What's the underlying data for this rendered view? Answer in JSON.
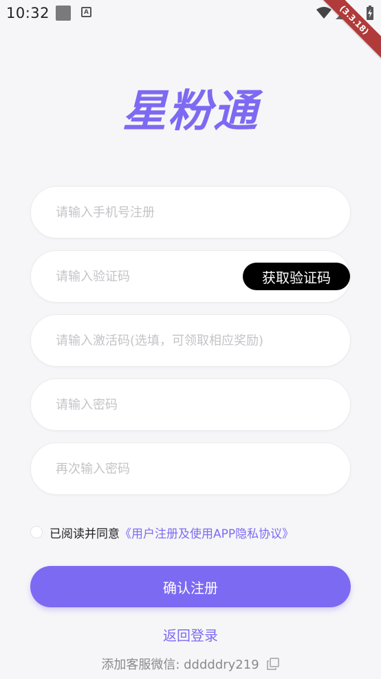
{
  "status_bar": {
    "time": "10:32",
    "a_icon_text": "A",
    "debug_banner": "(3.3.18)"
  },
  "logo": {
    "text": "星粉通"
  },
  "form": {
    "phone_placeholder": "请输入手机号注册",
    "code_placeholder": "请输入验证码",
    "get_code_label": "获取验证码",
    "activation_placeholder": "请输入激活码(选填，可领取相应奖励)",
    "password_placeholder": "请输入密码",
    "password_confirm_placeholder": "再次输入密码"
  },
  "agreement": {
    "text": "已阅读并同意",
    "link": "《用户注册及使用APP隐私协议》",
    "checked": false
  },
  "submit_label": "确认注册",
  "back_login_label": "返回登录",
  "wechat": {
    "label": "添加客服微信: dddddry219"
  },
  "colors": {
    "accent": "#7d6af2",
    "background": "#f6f6f8",
    "button_black": "#000000",
    "debug_banner": "#b13a3a"
  }
}
